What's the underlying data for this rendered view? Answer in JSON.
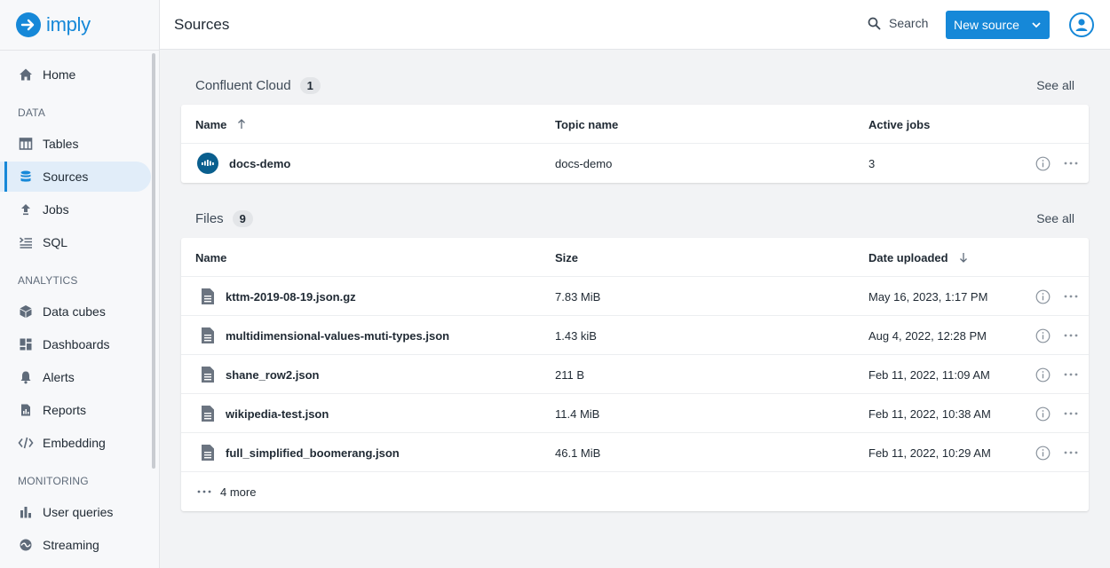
{
  "app": {
    "logo_text": "imply"
  },
  "header": {
    "title": "Sources",
    "search_label": "Search",
    "new_source_label": "New source"
  },
  "sidebar": {
    "items_top": [
      {
        "label": "Home",
        "icon": "home-icon"
      }
    ],
    "groups": [
      {
        "label": "DATA",
        "items": [
          {
            "label": "Tables",
            "icon": "table-icon"
          },
          {
            "label": "Sources",
            "icon": "database-icon",
            "active": true
          },
          {
            "label": "Jobs",
            "icon": "upload-icon"
          },
          {
            "label": "SQL",
            "icon": "sql-icon"
          }
        ]
      },
      {
        "label": "ANALYTICS",
        "items": [
          {
            "label": "Data cubes",
            "icon": "cube-icon"
          },
          {
            "label": "Dashboards",
            "icon": "dashboard-icon"
          },
          {
            "label": "Alerts",
            "icon": "bell-icon"
          },
          {
            "label": "Reports",
            "icon": "report-icon"
          },
          {
            "label": "Embedding",
            "icon": "code-icon"
          }
        ]
      },
      {
        "label": "MONITORING",
        "items": [
          {
            "label": "User queries",
            "icon": "bar-chart-icon"
          },
          {
            "label": "Streaming",
            "icon": "streaming-icon"
          }
        ]
      }
    ]
  },
  "confluent": {
    "title": "Confluent Cloud",
    "count": "1",
    "see_all": "See all",
    "columns": [
      "Name",
      "Topic name",
      "Active jobs"
    ],
    "rows": [
      {
        "name": "docs-demo",
        "topic": "docs-demo",
        "active_jobs": "3"
      }
    ]
  },
  "files": {
    "title": "Files",
    "count": "9",
    "see_all": "See all",
    "columns": [
      "Name",
      "Size",
      "Date uploaded"
    ],
    "rows": [
      {
        "name": "kttm-2019-08-19.json.gz",
        "size": "7.83 MiB",
        "date": "May 16, 2023, 1:17 PM"
      },
      {
        "name": "multidimensional-values-muti-types.json",
        "size": "1.43 kiB",
        "date": "Aug 4, 2022, 12:28 PM"
      },
      {
        "name": "shane_row2.json",
        "size": "211 B",
        "date": "Feb 11, 2022, 11:09 AM"
      },
      {
        "name": "wikipedia-test.json",
        "size": "11.4 MiB",
        "date": "Feb 11, 2022, 10:38 AM"
      },
      {
        "name": "full_simplified_boomerang.json",
        "size": "46.1 MiB",
        "date": "Feb 11, 2022, 10:29 AM"
      }
    ],
    "more_label": "4 more"
  },
  "colors": {
    "accent": "#1688d8",
    "sidebar_bg": "#f7f8fa",
    "active_bg": "#e1edf9",
    "page_bg": "#f2f3f5"
  }
}
